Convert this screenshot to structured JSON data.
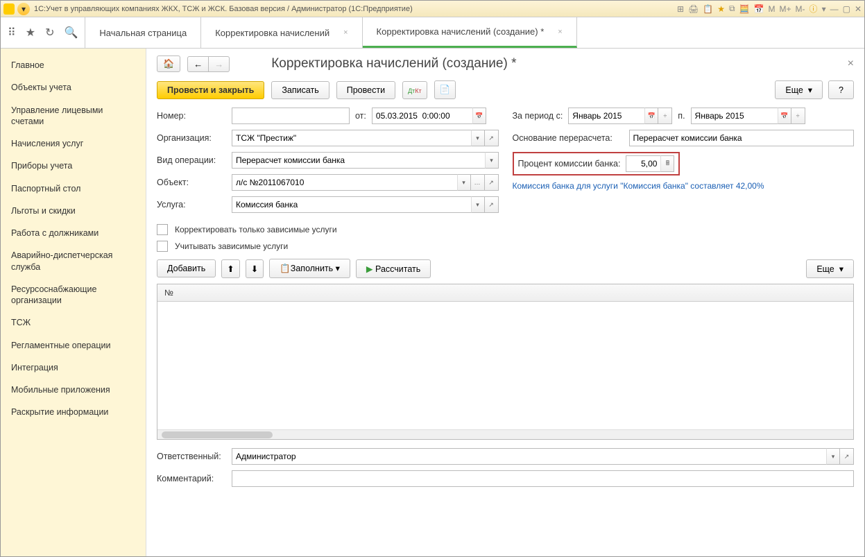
{
  "titlebar": {
    "text": "1С:Учет в управляющих компаниях ЖКХ, ТСЖ и ЖСК. Базовая версия / Администратор  (1С:Предприятие)",
    "icons": [
      "⊞",
      "🖨",
      "📋",
      "★",
      "⧉",
      "🧮",
      "📅",
      "M",
      "M+",
      "M-",
      "ⓘ",
      "▾",
      "—",
      "▢",
      "✕"
    ]
  },
  "tabs": [
    {
      "label": "Начальная страница",
      "closable": false,
      "active": false
    },
    {
      "label": "Корректировка начислений",
      "closable": true,
      "active": false
    },
    {
      "label": "Корректировка начислений (создание) *",
      "closable": true,
      "active": true
    }
  ],
  "sidebar": {
    "items": [
      "Главное",
      "Объекты учета",
      "Управление лицевыми счетами",
      "Начисления услуг",
      "Приборы учета",
      "Паспортный стол",
      "Льготы и скидки",
      "Работа с должниками",
      "Аварийно-диспетчерская служба",
      "Ресурсоснабжающие организации",
      "ТСЖ",
      "Регламентные операции",
      "Интеграция",
      "Мобильные приложения",
      "Раскрытие информации"
    ]
  },
  "page": {
    "title": "Корректировка начислений (создание) *",
    "actions": {
      "post_close": "Провести и закрыть",
      "save": "Записать",
      "post": "Провести",
      "more": "Еще",
      "help": "?"
    },
    "fields": {
      "number_label": "Номер:",
      "number": "",
      "ot_label": "от:",
      "date": "05.03.2015  0:00:00",
      "period_from_label": "За период с:",
      "period_from": "Январь 2015",
      "po_label": "п.",
      "period_to": "Январь 2015",
      "org_label": "Организация:",
      "org": "ТСЖ \"Престиж\"",
      "basis_label": "Основание перерасчета:",
      "basis": "Перерасчет комиссии банка",
      "op_label": "Вид операции:",
      "op": "Перерасчет комиссии банка",
      "commission_label": "Процент комиссии банка:",
      "commission": "5,00",
      "obj_label": "Объект:",
      "obj": "л/с №2011067010",
      "commission_link": "Комиссия банка для услуги \"Комиссия банка\" составляет 42,00%",
      "service_label": "Услуга:",
      "service": "Комиссия банка",
      "chk1": "Корректировать только зависимые услуги",
      "chk2": "Учитывать зависимые услуги"
    },
    "table_actions": {
      "add": "Добавить",
      "fill": "Заполнить",
      "calc": "Рассчитать",
      "more": "Еще"
    },
    "table": {
      "col_no": "№"
    },
    "footer": {
      "responsible_label": "Ответственный:",
      "responsible": "Администратор",
      "comment_label": "Комментарий:",
      "comment": ""
    }
  }
}
